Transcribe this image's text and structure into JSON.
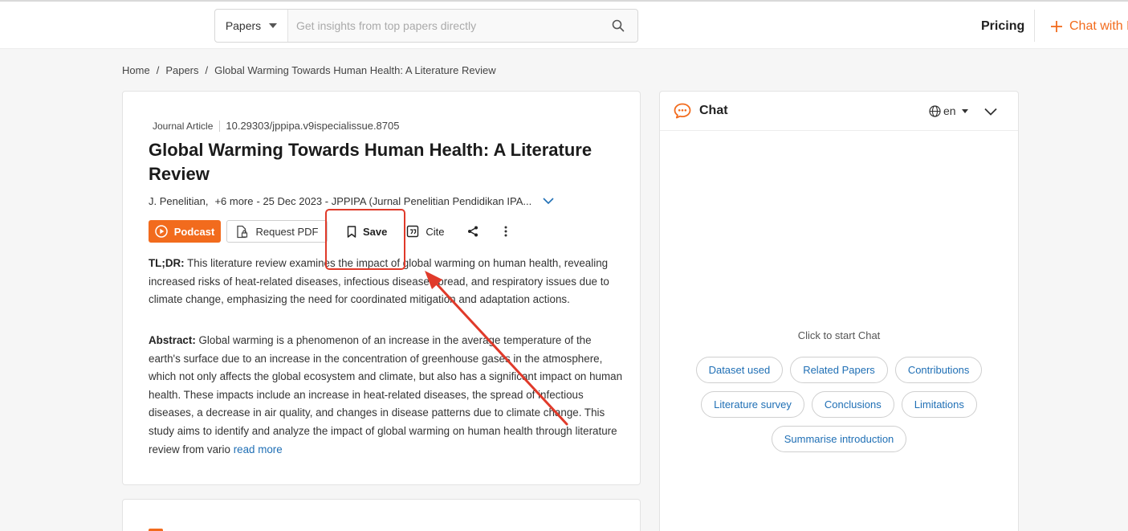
{
  "header": {
    "search_scope": "Papers",
    "search_placeholder": "Get insights from top papers directly",
    "pricing_label": "Pricing",
    "chat_label": "Chat with PDF"
  },
  "breadcrumb": {
    "home": "Home",
    "papers": "Papers",
    "current": "Global Warming Towards Human Health: A Literature Review",
    "separator": "/"
  },
  "paper": {
    "type": "Journal Article",
    "doi": "10.29303/jppipa.v9ispecialissue.8705",
    "title": "Global Warming Towards Human Health: A Literature Review",
    "author": "J. Penelitian,",
    "more_authors": "+6 more",
    "date_venue": "- 25 Dec 2023 - JPPIPA (Jurnal Penelitian Pendidikan IPA...",
    "actions": {
      "podcast": "Podcast",
      "request_pdf": "Request PDF",
      "save": "Save",
      "cite": "Cite"
    },
    "tldr_label": "TL;DR:",
    "tldr": "This literature review examines the impact of global warming on human health, revealing increased risks of heat-related diseases, infectious disease spread, and respiratory issues due to climate change, emphasizing the need for coordinated mitigation and adaptation actions.",
    "abstract_label": "Abstract:",
    "abstract": "Global warming is a phenomenon of an increase in the average temperature of the earth's surface due to an increase in the concentration of greenhouse gases in the atmosphere, which not only affects the global ecosystem and climate, but also has a significant impact on human health. These impacts include an increase in heat-related diseases, the spread of infectious diseases, a decrease in air quality, and changes in disease patterns due to climate change. This study aims to identify and analyze the impact of global warming on human health through literature review from vario",
    "read_more": "read more"
  },
  "chat": {
    "title": "Chat",
    "language": "en",
    "hint": "Click to start Chat",
    "chips": [
      [
        "Dataset used",
        "Related Papers",
        "Contributions"
      ],
      [
        "Literature survey",
        "Conclusions",
        "Limitations"
      ],
      [
        "Summarise introduction"
      ]
    ]
  },
  "colors": {
    "accent": "#f26b1d",
    "link": "#1f6fb5",
    "annotation": "#e03a2a"
  }
}
